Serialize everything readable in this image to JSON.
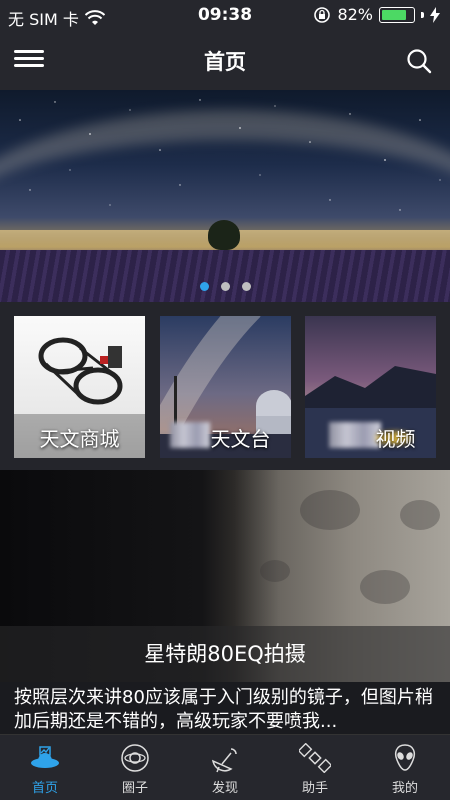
{
  "status_bar": {
    "carrier": "无 SIM 卡",
    "time": "09:38",
    "battery_percent": "82%",
    "battery_level": 0.82,
    "battery_color": "#4cd964"
  },
  "header": {
    "title": "首页",
    "menu_icon": "hamburger-icon",
    "search_icon": "search-icon"
  },
  "banner": {
    "slide_count": 3,
    "active_index": 0,
    "active_dot_color": "#2fa3ea"
  },
  "cards": [
    {
      "label": "天文商城"
    },
    {
      "label": "天文台"
    },
    {
      "label": "视频"
    }
  ],
  "feature": {
    "caption": "星特朗80EQ拍摄",
    "description": "按照层次来讲80应该属于入门级别的镜子，但图片稍加后期还是不错的，高级玩家不要喷我..."
  },
  "tab_bar": {
    "items": [
      {
        "label": "首页",
        "icon": "home-ufo-icon",
        "active": true
      },
      {
        "label": "圈子",
        "icon": "planet-orbit-icon",
        "active": false
      },
      {
        "label": "发现",
        "icon": "satellite-dish-icon",
        "active": false
      },
      {
        "label": "助手",
        "icon": "satellite-icon",
        "active": false
      },
      {
        "label": "我的",
        "icon": "alien-icon",
        "active": false
      }
    ],
    "accent_color": "#2fa3ea"
  }
}
